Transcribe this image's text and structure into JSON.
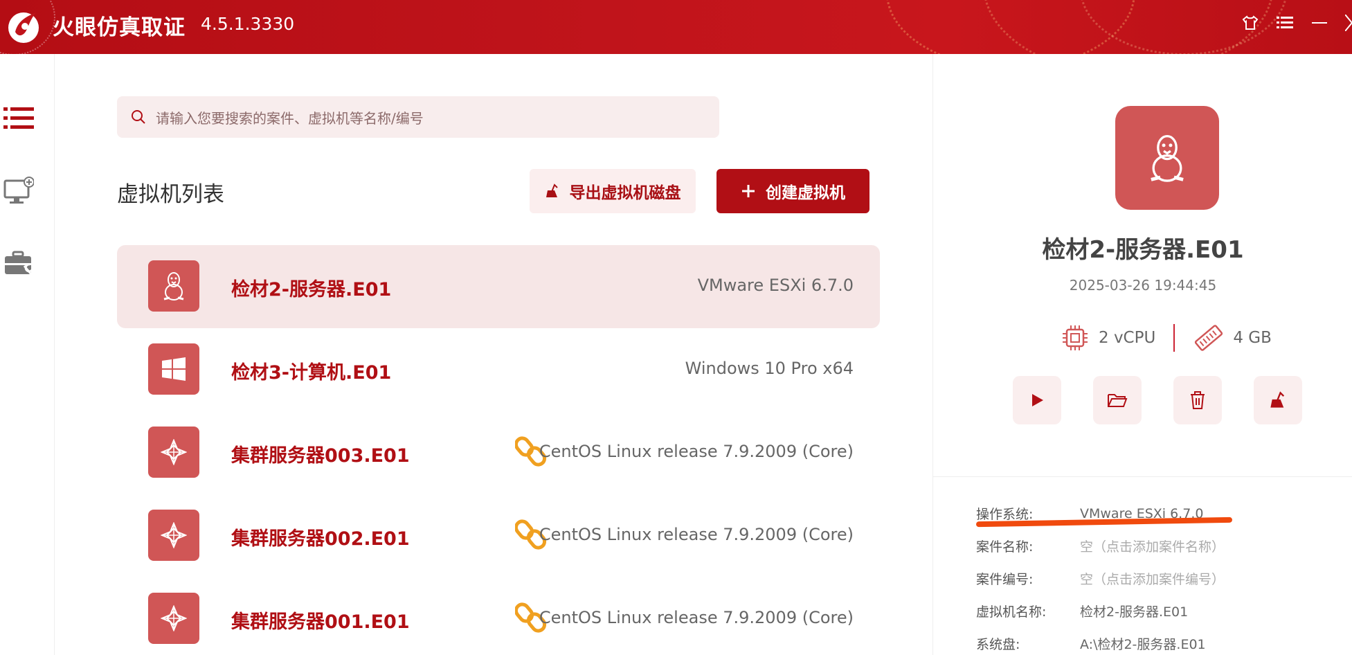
{
  "window": {
    "app_name": "火眼仿真取证",
    "version": "4.5.1.3330"
  },
  "search": {
    "placeholder": "请输入您要搜索的案件、虚拟机等名称/编号"
  },
  "list": {
    "title": "虚拟机列表",
    "export_label": "导出虚拟机磁盘",
    "create_label": "创建虚拟机",
    "items": [
      {
        "name": "检材2-服务器.E01",
        "os": "VMware ESXi 6.7.0",
        "icon": "linux-tux-icon",
        "linked": false,
        "selected": true
      },
      {
        "name": "检材3-计算机.E01",
        "os": "Windows 10 Pro x64",
        "icon": "windows-icon",
        "linked": false,
        "selected": false
      },
      {
        "name": "集群服务器003.E01",
        "os": "CentOS Linux release 7.9.2009 (Core)",
        "icon": "centos-icon",
        "linked": true,
        "selected": false
      },
      {
        "name": "集群服务器002.E01",
        "os": "CentOS Linux release 7.9.2009 (Core)",
        "icon": "centos-icon",
        "linked": true,
        "selected": false
      },
      {
        "name": "集群服务器001.E01",
        "os": "CentOS Linux release 7.9.2009 (Core)",
        "icon": "centos-icon",
        "linked": true,
        "selected": false
      }
    ]
  },
  "detail": {
    "name": "检材2-服务器.E01",
    "timestamp": "2025-03-26 19:44:45",
    "cpu": "2 vCPU",
    "memory": "4 GB",
    "info": [
      {
        "label": "操作系统:",
        "value": "VMware ESXi 6.7.0",
        "muted": false
      },
      {
        "label": "案件名称:",
        "value": "空（点击添加案件名称）",
        "muted": true
      },
      {
        "label": "案件编号:",
        "value": "空（点击添加案件编号）",
        "muted": true
      },
      {
        "label": "虚拟机名称:",
        "value": "检材2-服务器.E01",
        "muted": false
      },
      {
        "label": "系统盘:",
        "value": "A:\\检材2-服务器.E01",
        "muted": false
      }
    ]
  },
  "colors": {
    "brand": "#b10f15",
    "icon_bg": "#d05656",
    "link_orange": "#f0a020",
    "annotation_orange": "#f04a0e"
  }
}
